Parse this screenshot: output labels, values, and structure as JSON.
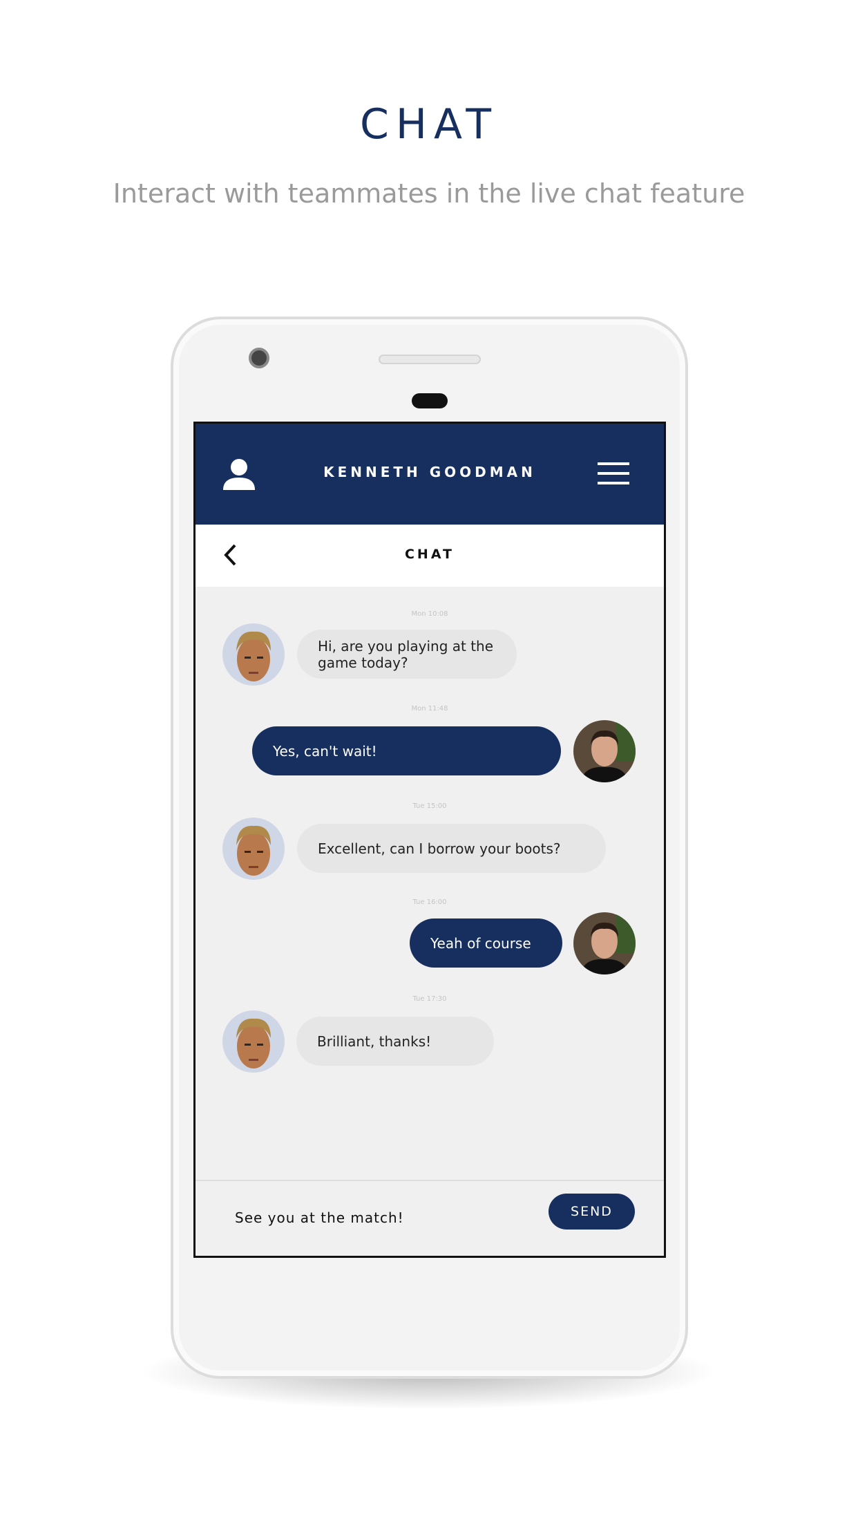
{
  "page": {
    "title": "CHAT",
    "subtitle": "Interact with teammates in the live chat feature"
  },
  "header": {
    "name": "KENNETH GOODMAN",
    "left_icon": "user-icon",
    "right_icon": "menu-icon"
  },
  "subheader": {
    "title": "CHAT",
    "back_icon": "chevron-left-icon"
  },
  "messages": [
    {
      "time": "Mon 10:08",
      "text": "Hi, are you playing at the game today?",
      "direction": "incoming"
    },
    {
      "time": "Mon 11:48",
      "text": "Yes, can't wait!",
      "direction": "outgoing"
    },
    {
      "time": "Tue 15:00",
      "text": "Excellent, can I borrow your boots?",
      "direction": "incoming"
    },
    {
      "time": "Tue 16:00",
      "text": "Yeah of course",
      "direction": "outgoing"
    },
    {
      "time": "Tue 17:30",
      "text": "Brilliant, thanks!",
      "direction": "incoming"
    }
  ],
  "composer": {
    "value": "See you at the match!",
    "send_label": "SEND"
  },
  "colors": {
    "brand": "#172f5f",
    "incoming_bubble": "#e6e6e6",
    "background": "#f0f0f0"
  }
}
